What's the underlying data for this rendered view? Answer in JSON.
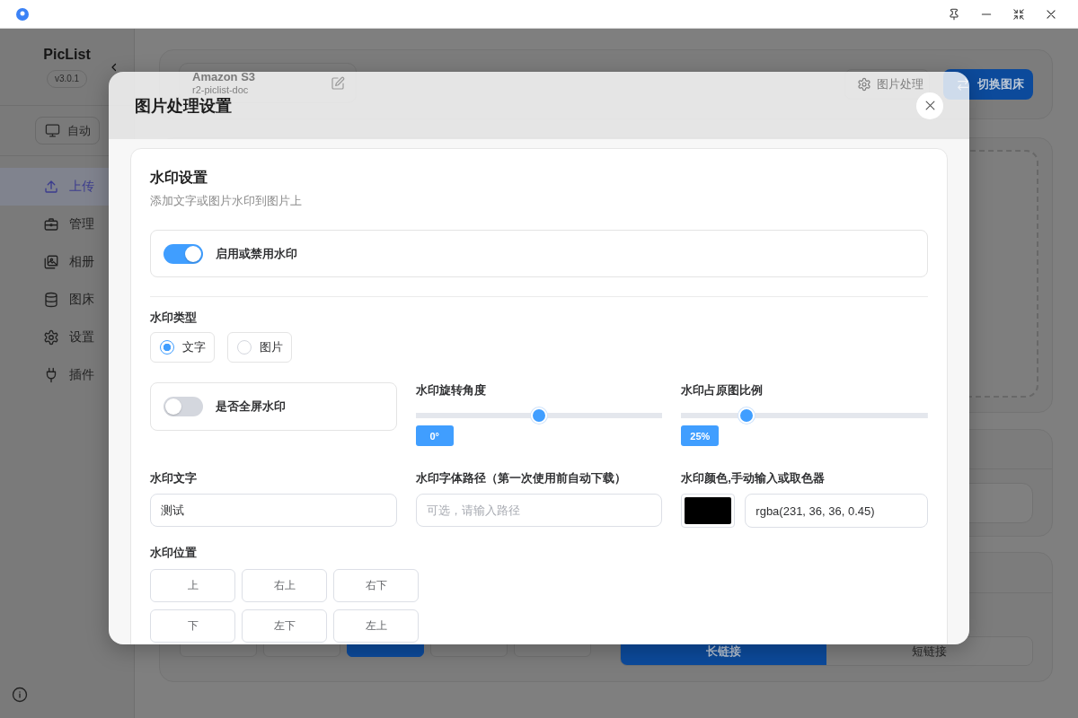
{
  "sidebar": {
    "app_name": "PicList",
    "version": "v3.0.1",
    "theme_button": "自动",
    "items": [
      {
        "label": "上传",
        "selected": true
      },
      {
        "label": "管理",
        "selected": false
      },
      {
        "label": "相册",
        "selected": false
      },
      {
        "label": "图床",
        "selected": false
      },
      {
        "label": "设置",
        "selected": false
      },
      {
        "label": "插件",
        "selected": false
      }
    ]
  },
  "uploader": {
    "bed_name": "Amazon S3",
    "config_name": "r2-piclist-doc",
    "buttons": [
      {
        "label": "图片处理",
        "kind": "outline"
      },
      {
        "label": "切换图床",
        "kind": "primary"
      }
    ]
  },
  "output": {
    "formats": [
      {
        "selected": false
      },
      {
        "selected": false
      },
      {
        "selected": true
      },
      {
        "selected": false
      },
      {
        "selected": false
      }
    ],
    "link_types": [
      {
        "label": "长链接",
        "selected": true
      },
      {
        "label": "短链接",
        "selected": false
      }
    ]
  },
  "dialog": {
    "title": "图片处理设置",
    "watermark": {
      "title": "水印设置",
      "description": "添加文字或图片水印到图片上",
      "enable": {
        "label": "启用或禁用水印",
        "on": true
      },
      "type": {
        "label": "水印类型",
        "options": [
          {
            "label": "文字",
            "selected": true
          },
          {
            "label": "图片",
            "selected": false
          }
        ]
      },
      "fullscreen": {
        "label": "是否全屏水印",
        "on": false
      },
      "rotation": {
        "label": "水印旋转角度",
        "level": 0.5,
        "reading": "0°"
      },
      "scale": {
        "label": "水印占原图比例",
        "level": 0.25,
        "reading": "25%"
      },
      "text": {
        "label": "水印文字",
        "value": "测试"
      },
      "font_path": {
        "label": "水印字体路径（第一次使用前自动下载）",
        "placeholder": "可选，请输入路径"
      },
      "color_field": {
        "label": "水印颜色,手动输入或取色器",
        "color": "#000000",
        "value": "rgba(231, 36, 36, 0.45)"
      },
      "position": {
        "label": "水印位置",
        "options": [
          {
            "label": "上",
            "selected": false
          },
          {
            "label": "右上",
            "selected": false
          },
          {
            "label": "右下",
            "selected": false
          },
          {
            "label": "下",
            "selected": false
          },
          {
            "label": "左下",
            "selected": false
          },
          {
            "label": "左上",
            "selected": false
          }
        ]
      }
    }
  }
}
